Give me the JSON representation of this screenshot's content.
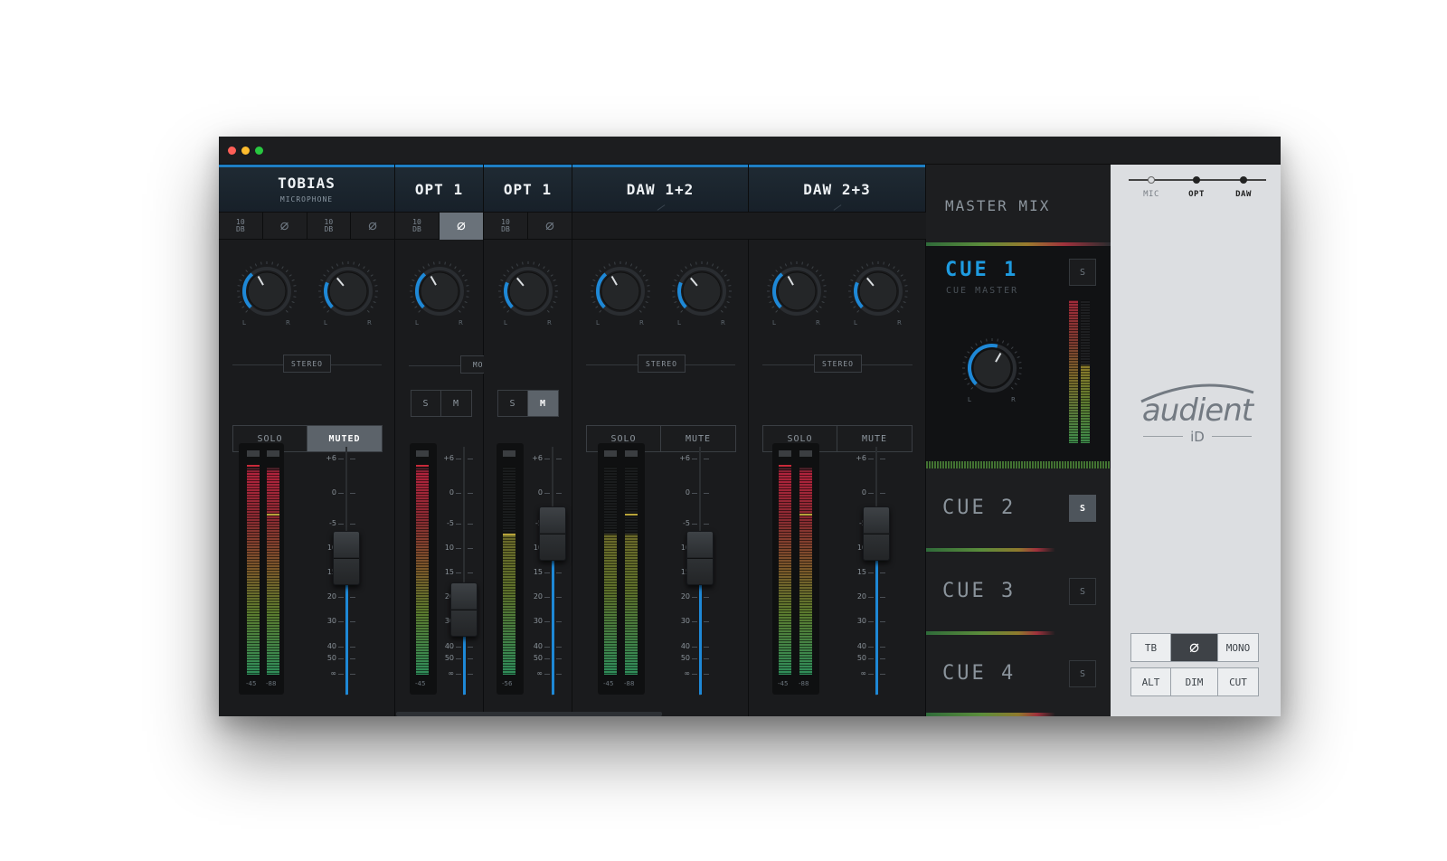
{
  "window": {
    "traffic_colors": [
      "#fe5f57",
      "#febc2e",
      "#28c840"
    ]
  },
  "strips": [
    {
      "name": "TOBIAS",
      "sub": "MICROPHONE",
      "controls": [
        {
          "label": "10\nDB",
          "type": "pad",
          "active": false
        },
        {
          "label": "∅",
          "type": "phase",
          "active": false
        },
        {
          "label": "10\nDB",
          "type": "pad",
          "active": false
        },
        {
          "label": "∅",
          "type": "phase",
          "active": false
        }
      ],
      "mode": "STEREO",
      "buttons": [
        {
          "label": "SOLO",
          "on": false
        },
        {
          "label": "MUTED",
          "on": true
        }
      ],
      "meter_labels": [
        "-45",
        "-88"
      ],
      "fader_level_db": -12
    },
    {
      "name": "OPT 1",
      "sub": "",
      "controls": [
        {
          "label": "10\nDB",
          "type": "pad",
          "active": false
        },
        {
          "label": "∅",
          "type": "phase",
          "active": true
        }
      ],
      "mode": "MONO",
      "buttons": [
        {
          "label": "S",
          "on": false
        },
        {
          "label": "M",
          "on": false
        }
      ],
      "meter_labels": [
        "-45"
      ],
      "fader_level_db": -25
    },
    {
      "name": "OPT 1",
      "sub": "",
      "controls": [
        {
          "label": "10\nDB",
          "type": "pad",
          "active": false
        },
        {
          "label": "∅",
          "type": "phase",
          "active": false
        }
      ],
      "mode": "",
      "buttons": [
        {
          "label": "S",
          "on": false
        },
        {
          "label": "M",
          "on": true
        }
      ],
      "meter_labels": [
        "-56"
      ],
      "fader_level_db": -7
    },
    {
      "name": "DAW 1+2",
      "sub": "",
      "controls": [],
      "mode": "STEREO",
      "buttons": [
        {
          "label": "SOLO",
          "on": false
        },
        {
          "label": "MUTE",
          "on": false
        }
      ],
      "meter_labels": [
        "-45",
        "-88"
      ],
      "fader_level_db": -12
    },
    {
      "name": "DAW 2+3",
      "sub": "",
      "controls": [],
      "mode": "STEREO",
      "buttons": [
        {
          "label": "SOLO",
          "on": false
        },
        {
          "label": "MUTE",
          "on": false
        }
      ],
      "meter_labels": [
        "-45",
        "-88"
      ],
      "fader_level_db": -7
    }
  ],
  "fader_scale": [
    "+6",
    "0",
    "-5",
    "10",
    "15",
    "20",
    "30",
    "40",
    "50",
    "∞"
  ],
  "knob_labels": {
    "left": "L",
    "right": "R"
  },
  "cue": {
    "master_title": "MASTER MIX",
    "items": [
      {
        "name": "CUE 1",
        "sub": "CUE MASTER",
        "solo_label": "S",
        "solo_on": false,
        "active": true
      },
      {
        "name": "CUE 2",
        "sub": "",
        "solo_label": "S",
        "solo_on": true,
        "active": false
      },
      {
        "name": "CUE 3",
        "sub": "",
        "solo_label": "S",
        "solo_on": false,
        "active": false
      },
      {
        "name": "CUE 4",
        "sub": "",
        "solo_label": "S",
        "solo_on": false,
        "active": false
      }
    ]
  },
  "source": {
    "options": [
      {
        "label": "MIC",
        "selected": false
      },
      {
        "label": "OPT",
        "selected": true
      },
      {
        "label": "DAW",
        "selected": true
      }
    ]
  },
  "brand": {
    "word": "audient",
    "model": "iD"
  },
  "monitor": {
    "row1": [
      {
        "label": "TB",
        "on": false
      },
      {
        "label": "∅",
        "on": true
      },
      {
        "label": "MONO",
        "on": false
      }
    ],
    "row2": [
      {
        "label": "ALT",
        "on": false
      },
      {
        "label": "DIM",
        "on": false
      },
      {
        "label": "CUT",
        "on": false
      }
    ]
  },
  "colors": {
    "accent": "#1e88d6",
    "cue_active": "#1e9be0"
  }
}
